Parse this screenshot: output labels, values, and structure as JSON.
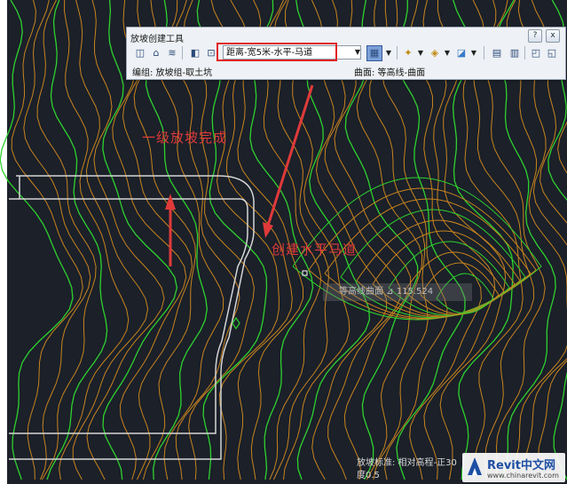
{
  "toolbar": {
    "title": "放坡创建工具",
    "criteria_value": "距离-宽5米-水平-马道",
    "status_left": "编组: 放坡组-取土坑",
    "status_right": "曲面: 等高线-曲面",
    "help_icon": "?",
    "close_icon": "x"
  },
  "annotations": {
    "level1_done": "一级放坡完成",
    "create_berm": "创建水平马道"
  },
  "map": {
    "faint_label": "等高线曲面 ⊿ 115.524",
    "bottom_info_line1": "放坡标准: 相对高程-正30",
    "bottom_info_line2": "度0.5"
  },
  "watermark": {
    "brand": "Revit中文网",
    "url": "www.chinarevit.com"
  },
  "colors": {
    "background": "#1b2029",
    "contour_orange": "#c8841e",
    "contour_green": "#2fd12f",
    "outline": "#d6d6d6",
    "annotation_red": "#e03a3a"
  }
}
